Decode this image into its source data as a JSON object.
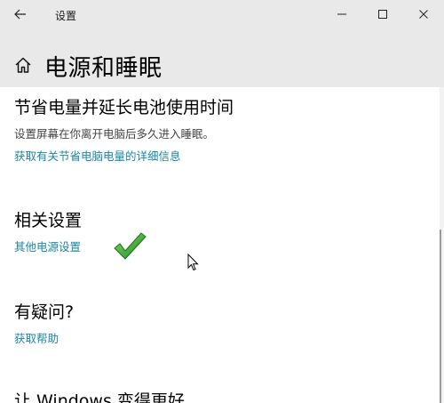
{
  "window": {
    "title": "设置"
  },
  "header": {
    "page_title": "电源和睡眠"
  },
  "sections": {
    "save_power": {
      "title": "节省电量并延长电池使用时间",
      "description": "设置屏幕在你离开电脑后多久进入睡眠。",
      "link": "获取有关节省电脑电量的详细信息"
    },
    "related": {
      "title": "相关设置",
      "link": "其他电源设置"
    },
    "question": {
      "title": "有疑问?",
      "link": "获取帮助"
    },
    "improve": {
      "title": "让 Windows 变得更好"
    }
  },
  "colors": {
    "link": "#1a86a8",
    "titlebar": "#e9e9e9",
    "checkmark": "#2e9e2e"
  },
  "icons": {
    "back": "back-arrow-icon",
    "home": "home-icon",
    "minimize": "minimize-icon",
    "maximize": "maximize-icon",
    "close": "close-icon",
    "annotation": "checkmark-icon",
    "cursor": "mouse-pointer-icon"
  }
}
